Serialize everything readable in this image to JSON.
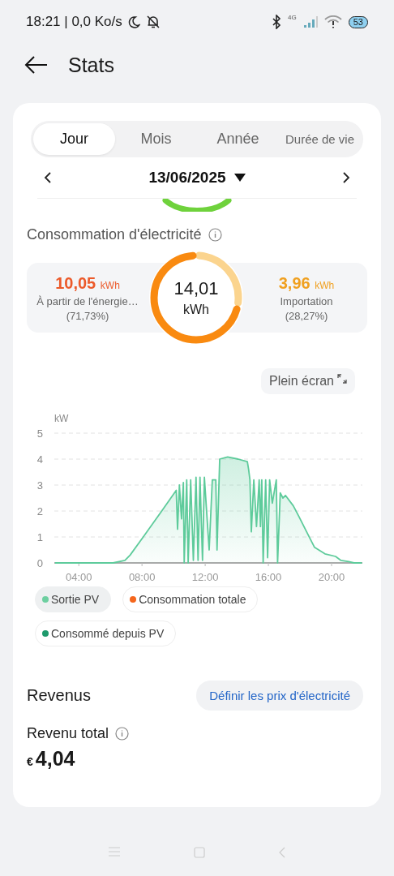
{
  "status_bar": {
    "time_speed": "18:21 | 0,0 Ko/s",
    "network": "4G",
    "battery": "53"
  },
  "header": {
    "title": "Stats"
  },
  "tabs": [
    {
      "label": "Jour",
      "selected": true
    },
    {
      "label": "Mois",
      "selected": false
    },
    {
      "label": "Année",
      "selected": false
    },
    {
      "label": "Durée de vie",
      "selected": false
    }
  ],
  "date": "13/06/2025",
  "consumption": {
    "title": "Consommation d'électricité",
    "total": "14,01",
    "total_unit": "kWh",
    "left": {
      "value": "10,05",
      "unit": "kWh",
      "label": "À partir de l'énergie…",
      "percent": "(71,73%)"
    },
    "right": {
      "value": "3,96",
      "unit": "kWh",
      "label": "Importation",
      "percent": "(28,27%)"
    }
  },
  "fullscreen_button": "Plein écran",
  "chart": {
    "chart_data": {
      "type": "area",
      "ylabel": "kW",
      "grid": true,
      "xlim": [
        2.45,
        21.95
      ],
      "ylim": [
        0,
        5
      ],
      "yticks": [
        0,
        1,
        2,
        3,
        4,
        5
      ],
      "xticks": [
        {
          "value": 4,
          "label": "04:00"
        },
        {
          "value": 8,
          "label": "08:00"
        },
        {
          "value": 12,
          "label": "12:00"
        },
        {
          "value": 16,
          "label": "16:00"
        },
        {
          "value": 20,
          "label": "20:00"
        }
      ],
      "x": [
        2.5,
        6.17,
        6.92,
        7.25,
        8.08,
        9.25,
        10.17,
        10.25,
        10.37,
        10.5,
        10.62,
        10.67,
        10.83,
        10.92,
        11.08,
        11.25,
        11.42,
        11.55,
        11.67,
        11.83,
        11.95,
        12.25,
        12.45,
        12.67,
        12.75,
        12.92,
        13.42,
        14.08,
        14.67,
        14.75,
        14.83,
        14.92,
        15.08,
        15.25,
        15.42,
        15.5,
        15.58,
        15.67,
        15.83,
        15.95,
        16.08,
        16.25,
        16.5,
        16.58,
        16.75,
        16.92,
        17.08,
        17.58,
        17.92,
        18.42,
        18.92,
        19.58,
        20.25,
        20.58,
        21.08,
        21.42,
        21.92
      ],
      "series": [
        {
          "name": "Sortie PV",
          "color": "#5ecb9b",
          "values": [
            0,
            0,
            0.1,
            0.3,
            1.0,
            2.0,
            2.8,
            1.3,
            3.0,
            1.7,
            3.1,
            0,
            3.2,
            0,
            3.2,
            0.1,
            3.3,
            0.1,
            3.3,
            0.1,
            3.3,
            0.5,
            3.2,
            3.2,
            0.5,
            4.0,
            4.08,
            4.0,
            3.9,
            3.6,
            3.2,
            1.2,
            3.2,
            1.4,
            3.2,
            1.4,
            3.2,
            0,
            3.2,
            0.2,
            3.2,
            2.3,
            3.2,
            0,
            2.7,
            2.5,
            2.6,
            2.2,
            1.8,
            1.2,
            0.6,
            0.35,
            0.25,
            0.1,
            0.05,
            0,
            0
          ]
        }
      ]
    },
    "legend": [
      {
        "color": "#6dcfa0",
        "selected": true
      },
      {
        "label": "Consommation totale",
        "color": "#f5661c",
        "selected": false
      },
      {
        "label": "Consommé depuis PV",
        "color": "#1e9a6c",
        "selected": false
      }
    ]
  },
  "revenue": {
    "title": "Revenus",
    "button": "Définir les prix d'électricité",
    "total_label": "Revenu total",
    "currency": "€",
    "total": "4,04"
  }
}
